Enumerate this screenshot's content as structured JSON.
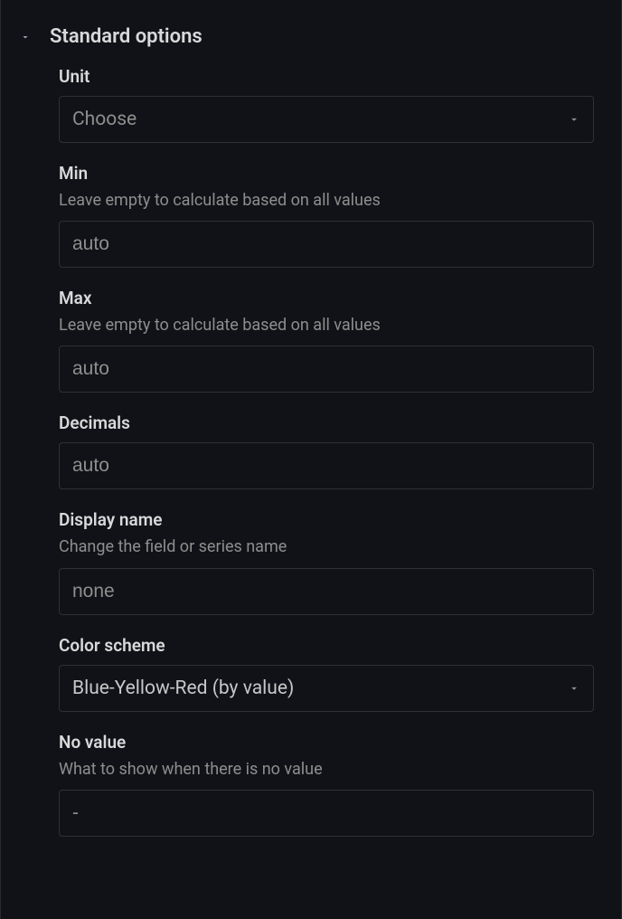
{
  "section": {
    "title": "Standard options"
  },
  "fields": {
    "unit": {
      "label": "Unit",
      "placeholder": "Choose"
    },
    "min": {
      "label": "Min",
      "description": "Leave empty to calculate based on all values",
      "placeholder": "auto"
    },
    "max": {
      "label": "Max",
      "description": "Leave empty to calculate based on all values",
      "placeholder": "auto"
    },
    "decimals": {
      "label": "Decimals",
      "placeholder": "auto"
    },
    "displayName": {
      "label": "Display name",
      "description": "Change the field or series name",
      "placeholder": "none"
    },
    "colorScheme": {
      "label": "Color scheme",
      "value": "Blue-Yellow-Red (by value)"
    },
    "noValue": {
      "label": "No value",
      "description": "What to show when there is no value",
      "placeholder": "-"
    }
  }
}
